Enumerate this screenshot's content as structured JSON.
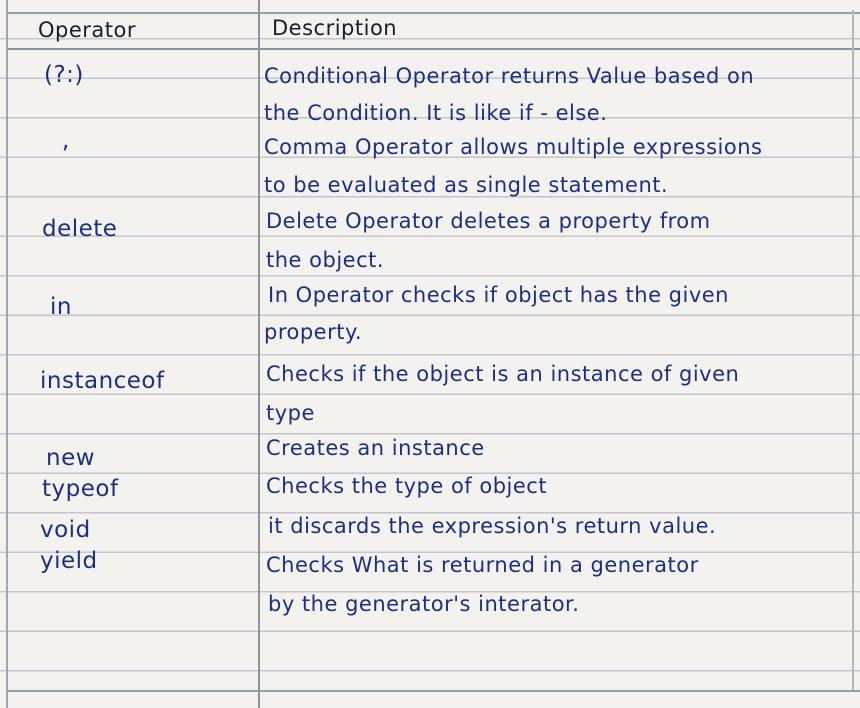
{
  "headers": {
    "operator": "Operator",
    "description": "Description"
  },
  "rows": [
    {
      "operator": "(?:)",
      "description": [
        "Conditional Operator returns Value based on",
        "the Condition. It is like if - else."
      ]
    },
    {
      "operator": ",",
      "description": [
        "Comma Operator allows multiple expressions",
        "to be evaluated as single statement."
      ]
    },
    {
      "operator": "delete",
      "description": [
        "Delete Operator deletes a property from",
        "the object."
      ]
    },
    {
      "operator": "in",
      "description": [
        "In Operator checks if object has the given",
        "property."
      ]
    },
    {
      "operator": "instanceof",
      "description": [
        "Checks if the object is an instance of given",
        "type"
      ]
    },
    {
      "operator": "new",
      "description": [
        "Creates an instance"
      ]
    },
    {
      "operator": "typeof",
      "description": [
        "Checks the type of object"
      ]
    },
    {
      "operator": "void",
      "description": [
        "it discards the expression's return value."
      ]
    },
    {
      "operator": "yield",
      "description": [
        "Checks What is returned in a generator",
        "by the generator's interator."
      ]
    }
  ]
}
